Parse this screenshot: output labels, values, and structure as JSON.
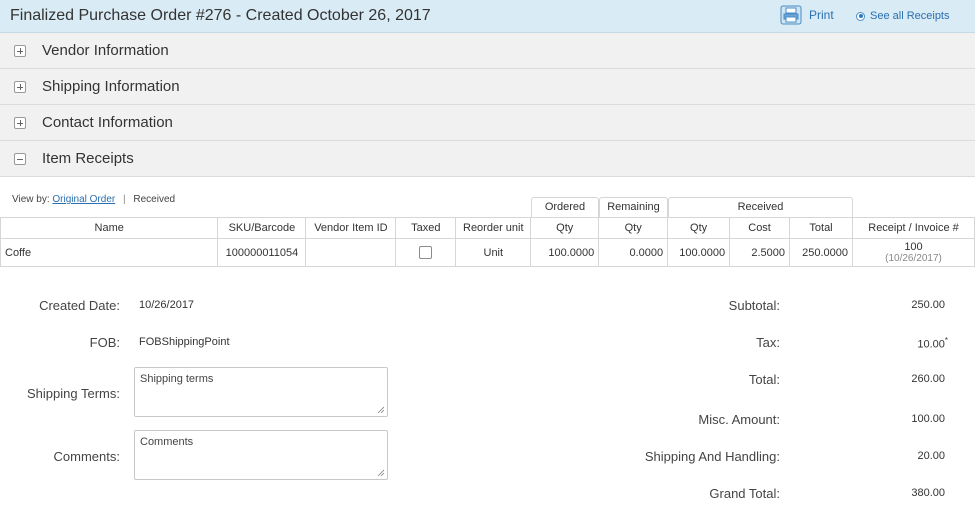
{
  "header": {
    "title": "Finalized Purchase Order #276 - Created October 26, 2017",
    "print_label": "Print",
    "see_all_label": "See all Receipts"
  },
  "sections": [
    {
      "label": "Vendor Information",
      "state": "collapsed"
    },
    {
      "label": "Shipping Information",
      "state": "collapsed"
    },
    {
      "label": "Contact Information",
      "state": "collapsed"
    },
    {
      "label": "Item Receipts",
      "state": "expanded"
    }
  ],
  "view_by": {
    "label": "View by:",
    "original_order": "Original Order",
    "separator": "|",
    "received": "Received"
  },
  "table": {
    "groups": {
      "ordered": "Ordered",
      "remaining": "Remaining",
      "received": "Received"
    },
    "columns": [
      "Name",
      "SKU/Barcode",
      "Vendor Item ID",
      "Taxed",
      "Reorder unit",
      "Qty",
      "Qty",
      "Qty",
      "Cost",
      "Total",
      "Receipt / Invoice #"
    ],
    "rows": [
      {
        "name": "Coffe",
        "sku": "100000011054",
        "vendor_item_id": "",
        "taxed": false,
        "reorder_unit": "Unit",
        "ordered_qty": "100.0000",
        "remaining_qty": "0.0000",
        "received_qty": "100.0000",
        "cost": "2.5000",
        "total": "250.0000",
        "receipt_number": "100",
        "receipt_date": "(10/26/2017)"
      }
    ]
  },
  "details": {
    "created_date_label": "Created Date:",
    "created_date": "10/26/2017",
    "fob_label": "FOB:",
    "fob": "FOBShippingPoint",
    "shipping_terms_label": "Shipping Terms:",
    "shipping_terms_value": "Shipping terms",
    "comments_label": "Comments:",
    "comments_value": "Comments"
  },
  "summary": {
    "subtotal_label": "Subtotal:",
    "subtotal": "250.00",
    "tax_label": "Tax:",
    "tax": "10.00",
    "tax_mark": "*",
    "total_label": "Total:",
    "total": "260.00",
    "misc_label": "Misc. Amount:",
    "misc": "100.00",
    "shipping_label": "Shipping And Handling:",
    "shipping": "20.00",
    "grand_total_label": "Grand Total:",
    "grand_total": "380.00"
  },
  "colors": {
    "header_bg": "#d9ebf5",
    "link": "#2a6fb0",
    "section_bg": "#f1f1f1"
  },
  "icons": {
    "print": "printer-icon",
    "expand": "plus-square-icon",
    "collapse": "minus-square-icon"
  }
}
